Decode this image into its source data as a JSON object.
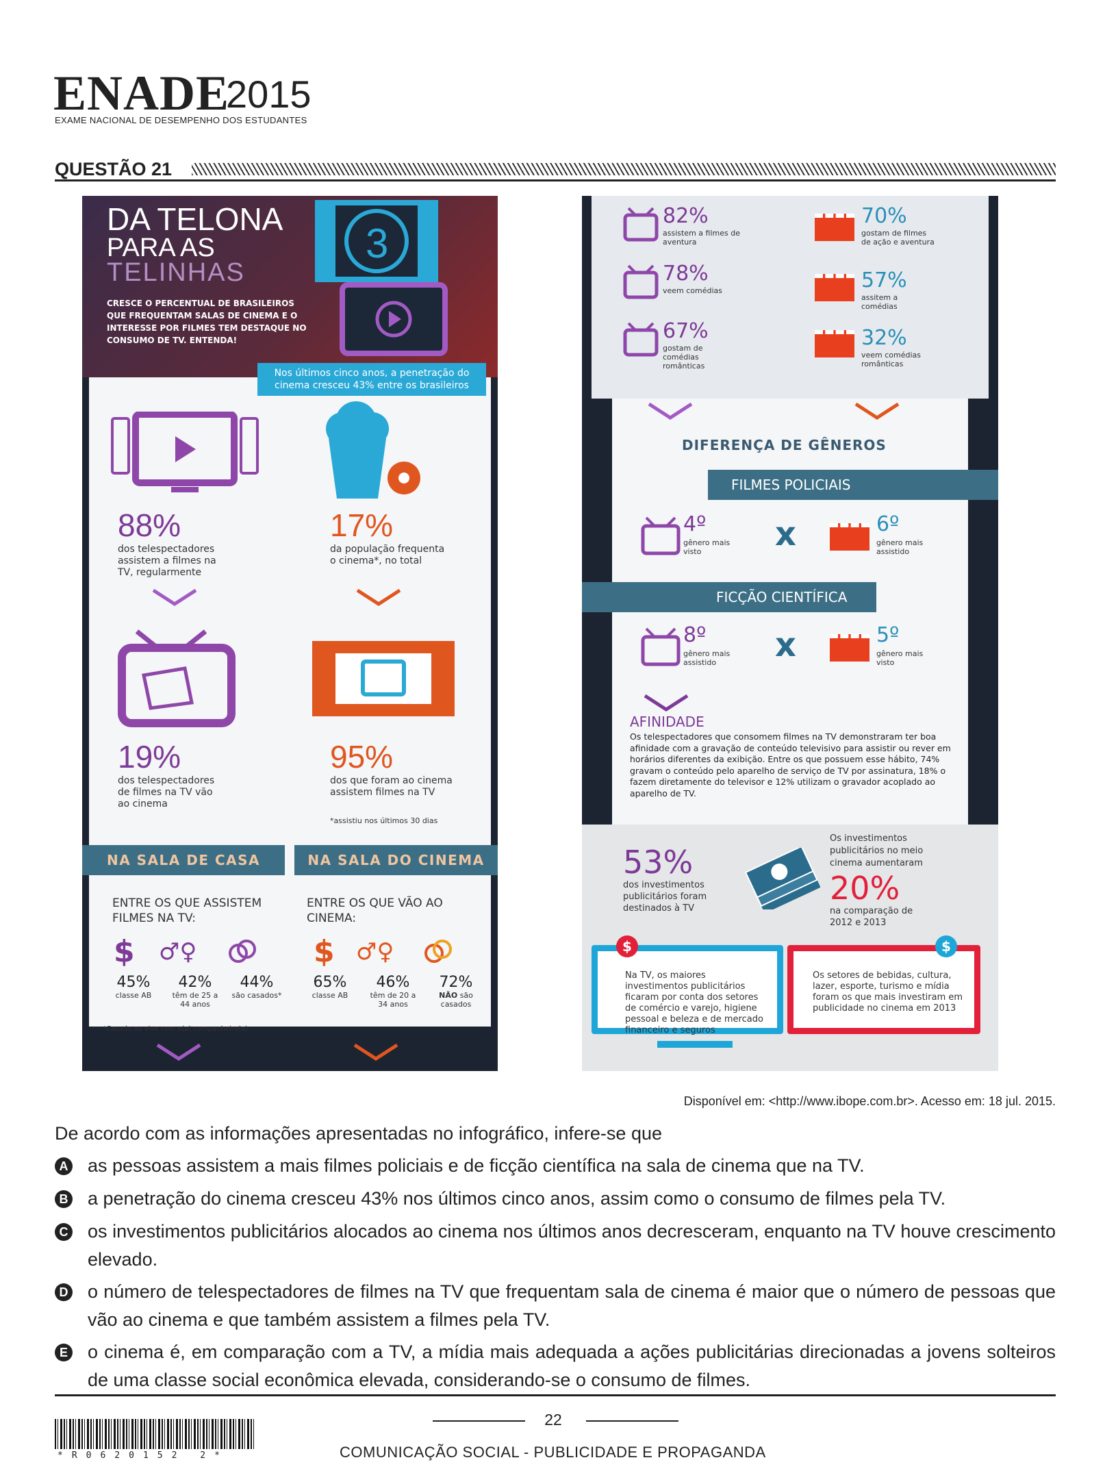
{
  "header": {
    "logo": "ENADE",
    "year": "2015",
    "subtitle": "EXAME NACIONAL DE DESEMPENHO DOS ESTUDANTES",
    "question": "QUESTÃO 21"
  },
  "info_left": {
    "title1": "DA TELONA",
    "title2": "PARA AS",
    "title3": "TELINHAS",
    "intro": "CRESCE O PERCENTUAL DE BRASILEIROS QUE FREQUENTAM SALAS DE CINEMA E O INTERESSE POR FILMES TEM DESTAQUE NO CONSUMO DE TV. ENTENDA!",
    "callout": "Nos últimos cinco anos, a penetração do cinema cresceu 43% entre os brasileiros",
    "s1_pct": "88%",
    "s1_text": "dos telespectadores assistem a filmes na TV, regularmente",
    "s2_pct": "17%",
    "s2_text": "da população frequenta o cinema*, no total",
    "s3_pct": "19%",
    "s3_text": "dos telespectadores de filmes na TV vão ao cinema",
    "s4_pct": "95%",
    "s4_text": "dos que foram ao cinema assistem filmes na TV",
    "s4_note": "*assistiu nos últimos 30 dias",
    "band1": "NA SALA DE CASA",
    "band2": "NA SALA DO CINEMA",
    "home_head": "ENTRE OS QUE ASSISTEM FILMES NA TV:",
    "cinema_head": "ENTRE OS QUE VÃO AO CINEMA:",
    "home": [
      {
        "pct": "45%",
        "label": "classe AB"
      },
      {
        "pct": "42%",
        "label": "têm de 25 a 44 anos"
      },
      {
        "pct": "44%",
        "label": "são casados*"
      }
    ],
    "cinema": [
      {
        "pct": "65%",
        "label": "classe AB"
      },
      {
        "pct": "46%",
        "label": "têm de 20 a 34 anos"
      },
      {
        "pct": "72%",
        "label_bold": "NÃO",
        "label": "são casados"
      }
    ],
    "footnote": "*Casado ou vive com o(a) companheiro(a)"
  },
  "info_right": {
    "tv": [
      {
        "pct": "82%",
        "label": "assistem a filmes de aventura"
      },
      {
        "pct": "78%",
        "label": "veem comédias"
      },
      {
        "pct": "67%",
        "label": "gostam de comédias românticas"
      }
    ],
    "cine": [
      {
        "pct": "70%",
        "label": "gostam de filmes de ação e aventura"
      },
      {
        "pct": "57%",
        "label": "assitem a comédias"
      },
      {
        "pct": "32%",
        "label": "veem comédias românticas"
      }
    ],
    "diff": "DIFERENÇA DE GÊNEROS",
    "police": "FILMES POLICIAIS",
    "scifi": "FICÇÃO CIENTÍFICA",
    "police_tv_rank": "4º",
    "police_tv_label": "gênero mais visto",
    "police_cine_rank": "6º",
    "police_cine_label": "gênero mais assistido",
    "scifi_tv_rank": "8º",
    "scifi_tv_label": "gênero mais assistido",
    "scifi_cine_rank": "5º",
    "scifi_cine_label": "gênero mais visto",
    "vs": "x",
    "afinidade": "AFINIDADE",
    "afinidade_text": "Os telespectadores que consomem filmes na TV demonstraram ter boa afinidade com a gravação de conteúdo televisivo para assistir ou rever em horários diferentes da exibição. Entre os que possuem esse hábito, 74% gravam o conteúdo pelo aparelho de serviço de TV por assinatura, 18% o fazem diretamente do televisor e 12% utilizam o gravador acoplado ao aparelho de TV.",
    "inv_pct": "53%",
    "inv_text": "dos investimentos publicitários foram destinados à TV",
    "cin_inv_head": "Os investimentos publicitários no meio cinema aumentaram",
    "cin_inv_pct": "20%",
    "cin_inv_text": "na comparação de 2012 e 2013",
    "box_tv": "Na TV, os maiores investimentos publicitários ficaram por conta dos setores de comércio e varejo, higiene pessoal e beleza e de mercado financeiro e seguros",
    "box_cine": "Os setores de bebidas, cultura, lazer, esporte, turismo e mídia foram os que mais investiram em publicidade no cinema em 2013",
    "dollar": "$"
  },
  "source": "Disponível em: <http://www.ibope.com.br>. Acesso em: 18 jul. 2015.",
  "stem": "De acordo com as informações apresentadas no infográfico, infere-se que",
  "options": [
    {
      "letter": "A",
      "text": "as pessoas assistem a mais filmes policiais e de ficção científica na sala de cinema que na TV."
    },
    {
      "letter": "B",
      "text": "a penetração do cinema cresceu 43% nos últimos cinco anos, assim como o consumo de filmes pela TV."
    },
    {
      "letter": "C",
      "text": "os investimentos publicitários alocados ao cinema nos últimos anos decresceram, enquanto na TV houve crescimento elevado."
    },
    {
      "letter": "D",
      "text": "o número de telespectadores de filmes na TV que frequentam sala de cinema é maior que o número de pessoas que vão ao cinema e que também assistem a filmes pela TV."
    },
    {
      "letter": "E",
      "text": "o cinema é, em comparação com a TV, a mídia mais adequada a ações publicitárias direcionadas a jovens solteiros de uma classe social econômica elevada, considerando-se o consumo de filmes."
    }
  ],
  "page": "22",
  "footer": "COMUNICAÇÃO SOCIAL - PUBLICIDADE E PROPAGANDA",
  "barcode": "*R0620152 2*",
  "colors": {
    "purple": "#7d3a96",
    "orange": "#e0561f",
    "teal": "#3c6f85",
    "cyan": "#1fa6d8",
    "red": "#e2203a"
  }
}
